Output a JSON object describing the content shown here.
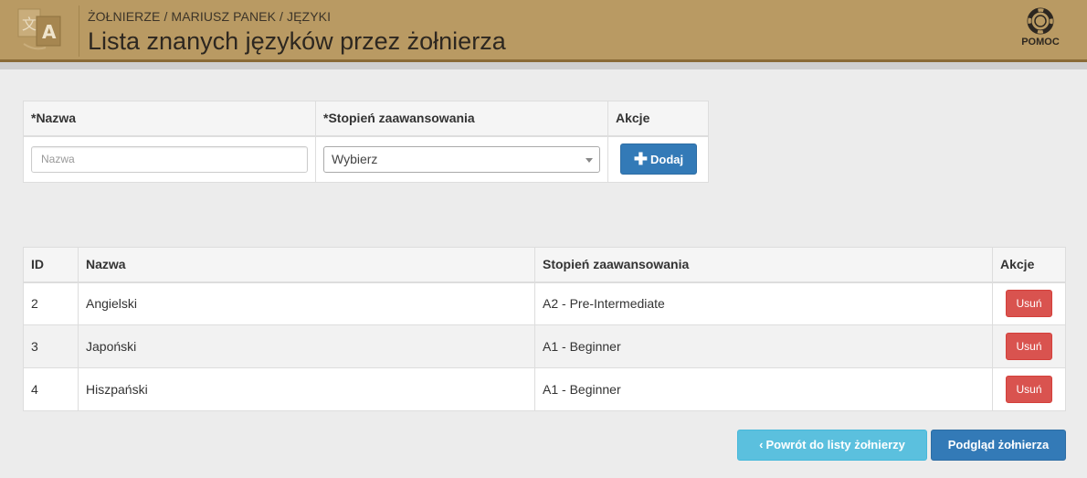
{
  "header": {
    "breadcrumb": "ŻOŁNIERZE / MARIUSZ PANEK / JĘZYKI",
    "title": "Lista znanych języków przez żołnierza",
    "help_label": "POMOC",
    "logo_icon": "translate-icon",
    "help_icon": "lifebuoy-icon"
  },
  "form": {
    "columns": [
      "*Nazwa",
      "*Stopień zaawansowania",
      "Akcje"
    ],
    "name_placeholder": "Nazwa",
    "name_value": "",
    "level_selected": "Wybierz",
    "add_label": "Dodaj"
  },
  "table": {
    "columns": [
      "ID",
      "Nazwa",
      "Stopień zaawansowania",
      "Akcje"
    ],
    "rows": [
      {
        "id": "2",
        "name": "Angielski",
        "level": "A2 - Pre-Intermediate",
        "action": "Usuń"
      },
      {
        "id": "3",
        "name": "Japoński",
        "level": "A1 - Beginner",
        "action": "Usuń"
      },
      {
        "id": "4",
        "name": "Hiszpański",
        "level": "A1 - Beginner",
        "action": "Usuń"
      }
    ]
  },
  "footer": {
    "back_label": "Powrót do listy żołnierzy",
    "view_label": "Podgląd żołnierza"
  },
  "colors": {
    "header_bg": "#b99a63",
    "primary": "#337ab7",
    "info": "#5bc0de",
    "danger": "#d9534f"
  }
}
